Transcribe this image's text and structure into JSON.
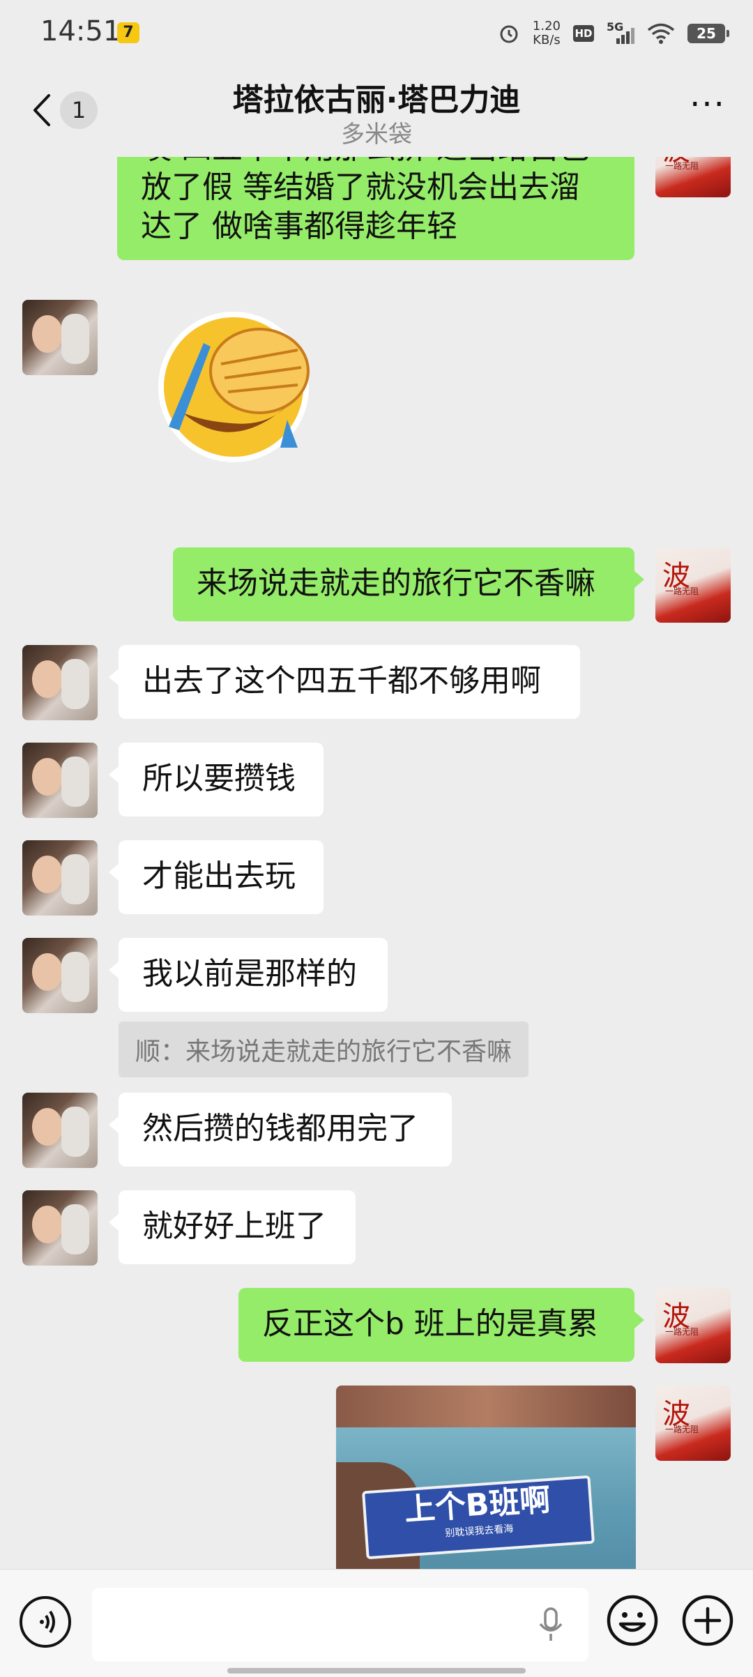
{
  "status_bar": {
    "time": "14:51",
    "app_badge": "7",
    "net_speed_value": "1.20",
    "net_speed_unit": "KB/s",
    "hd": "HD",
    "signal": "5G",
    "battery": "25"
  },
  "header": {
    "back_count": "1",
    "title": "塔拉依古丽·塔巴力迪",
    "subtitle": "多米袋",
    "more": "···"
  },
  "messages": [
    {
      "side": "right",
      "text_lines": [
        "噢 四五千不用那么拼 适当给自己",
        "放了假 等结婚了就没机会出去溜",
        "达了 做啥事都得趁年轻"
      ]
    },
    {
      "side": "left",
      "type": "sticker",
      "sticker": "facepalm-laugh-emoji"
    },
    {
      "side": "right",
      "text": "来场说走就走的旅行它不香嘛"
    },
    {
      "side": "left",
      "text": "出去了这个四五千都不够用啊"
    },
    {
      "side": "left",
      "text": "所以要攒钱"
    },
    {
      "side": "left",
      "text": "才能出去玩"
    },
    {
      "side": "left",
      "text": "我以前是那样的",
      "quote": "顺：来场说走就走的旅行它不香嘛"
    },
    {
      "side": "left",
      "text": "然后攒的钱都用完了"
    },
    {
      "side": "left",
      "text": "就好好上班了"
    },
    {
      "side": "right",
      "text": "反正这个b 班上的是真累"
    },
    {
      "side": "right",
      "type": "image",
      "image_main_text": "上个B班啊",
      "image_sub_text": "别耽误我去看海"
    }
  ],
  "avatars": {
    "right_glyph": "波",
    "right_sub": "一路无阻"
  },
  "input": {
    "placeholder": ""
  },
  "icons": [
    "back-chevron-icon",
    "voice-icon",
    "mic-icon",
    "emoji-icon",
    "plus-icon",
    "alarm-icon",
    "wifi-icon",
    "signal-icon"
  ]
}
